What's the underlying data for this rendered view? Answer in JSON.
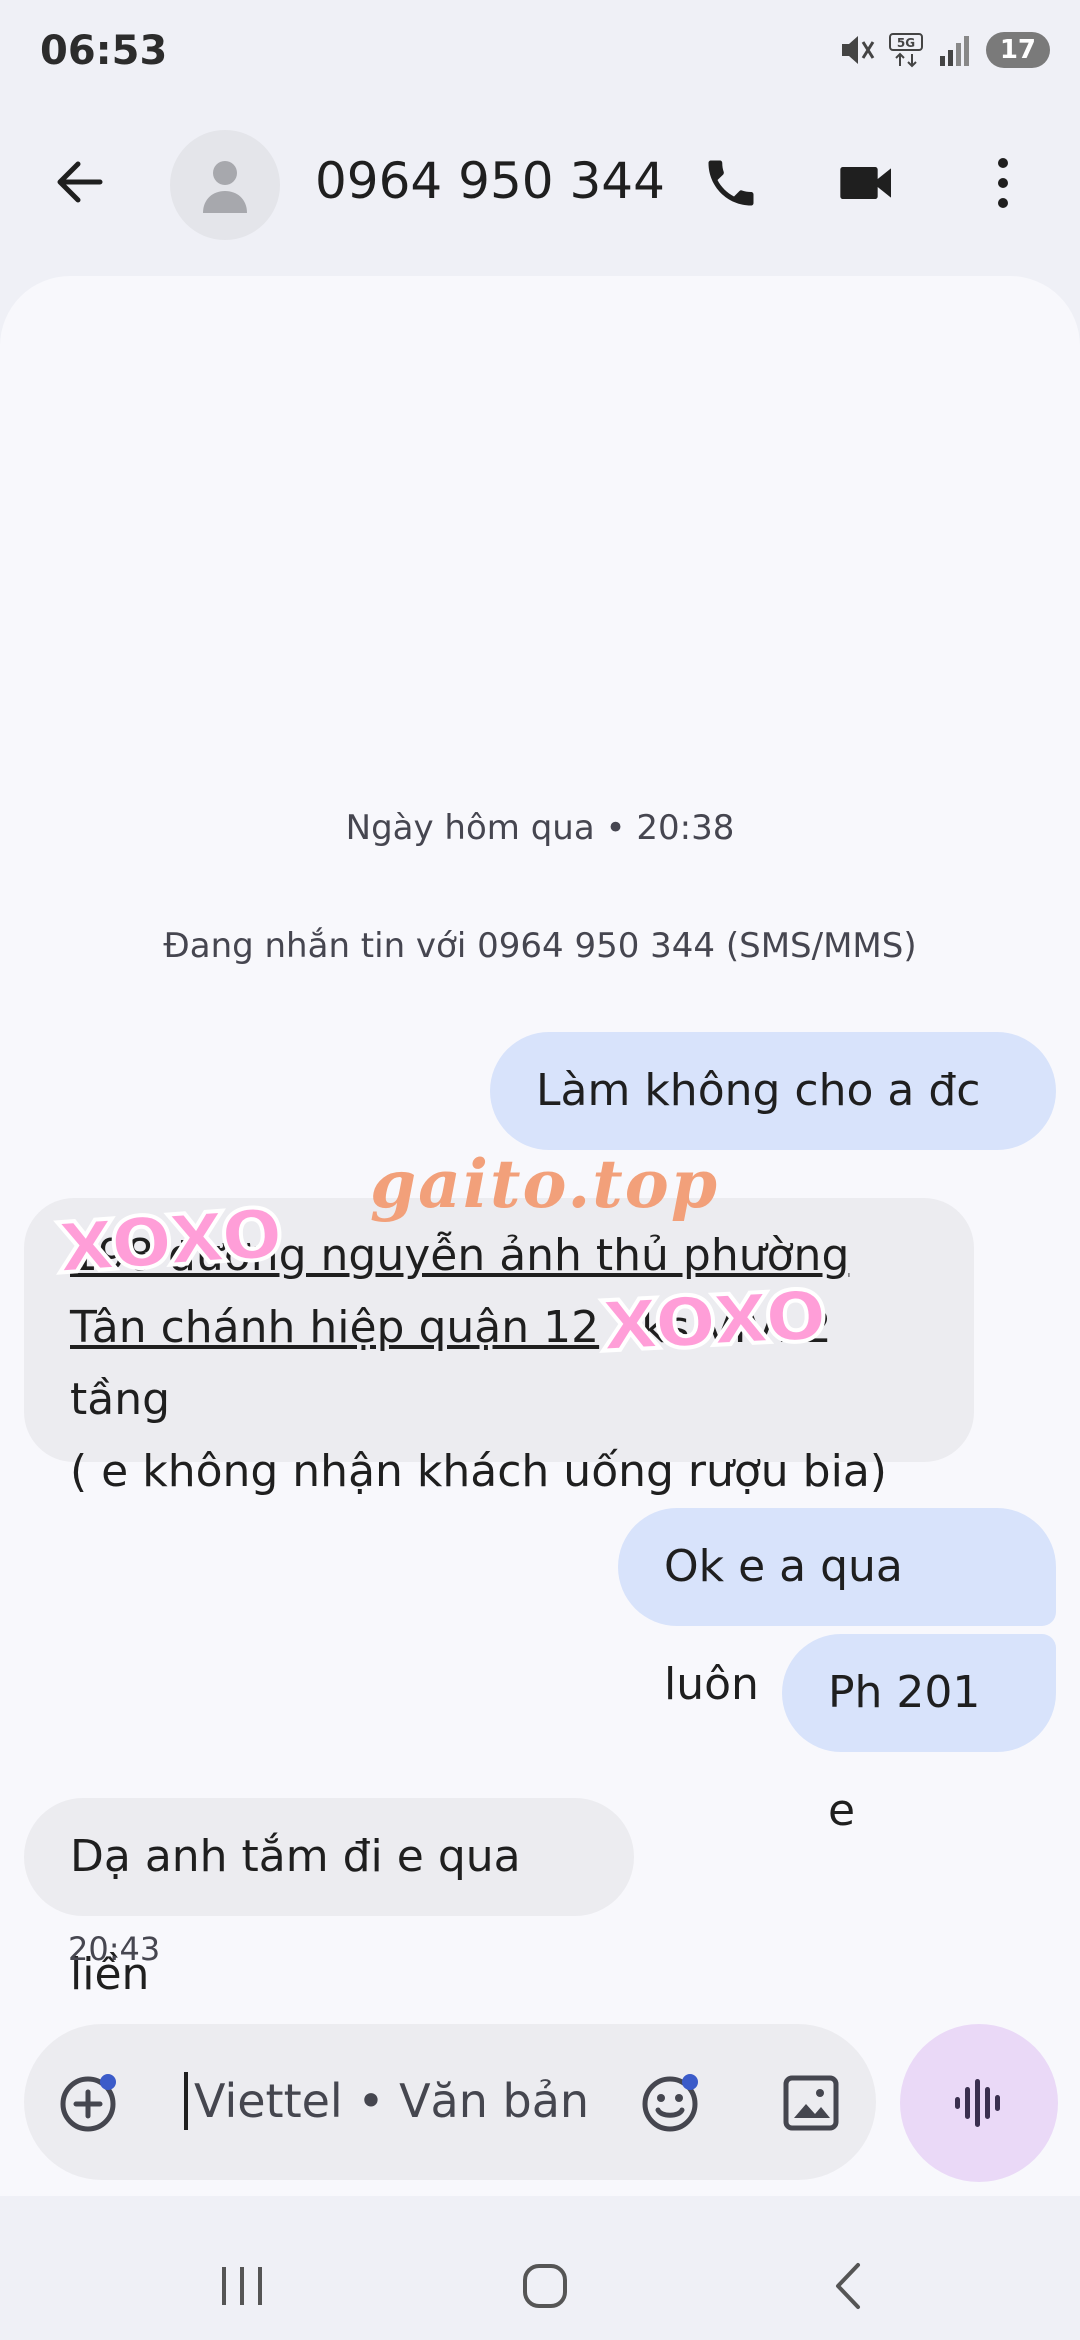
{
  "status_bar": {
    "time": "06:53",
    "battery": "17"
  },
  "header": {
    "contact": "0964 950 344"
  },
  "conversation": {
    "date_divider": "Ngày hôm qua • 20:38",
    "info": "Đang nhắn tin với 0964 950 344 (SMS/MMS)",
    "messages": [
      {
        "direction": "out",
        "text": "Làm không cho a đc e"
      },
      {
        "direction": "in",
        "lines": [
          {
            "parts": [
              "198 đường nguyễn ảnh thủ phường",
              ""
            ]
          },
          {
            "parts": [
              "Tân chánh hiệp quận 12",
              " . ks VIVI 2 tầng"
            ]
          },
          {
            "parts": [
              "( e không nhận khách uống rượu bia)",
              ""
            ]
          }
        ]
      },
      {
        "direction": "out",
        "text": "Ok e a qua luôn"
      },
      {
        "direction": "out",
        "text": "Ph 201 e"
      },
      {
        "direction": "in",
        "text": "Dạ anh tắm đi e qua liền"
      }
    ],
    "last_time": "20:43"
  },
  "composer": {
    "placeholder": "Viettel • Văn bản"
  },
  "watermark": {
    "site": "gaito.top",
    "sticker_1": "xoxo",
    "sticker_2": "xoxo"
  },
  "colors": {
    "outgoing_bubble": "#d8e3fb",
    "incoming_bubble": "#ececf0",
    "mic_button": "#ead9f7",
    "background": "#eff0f6"
  }
}
